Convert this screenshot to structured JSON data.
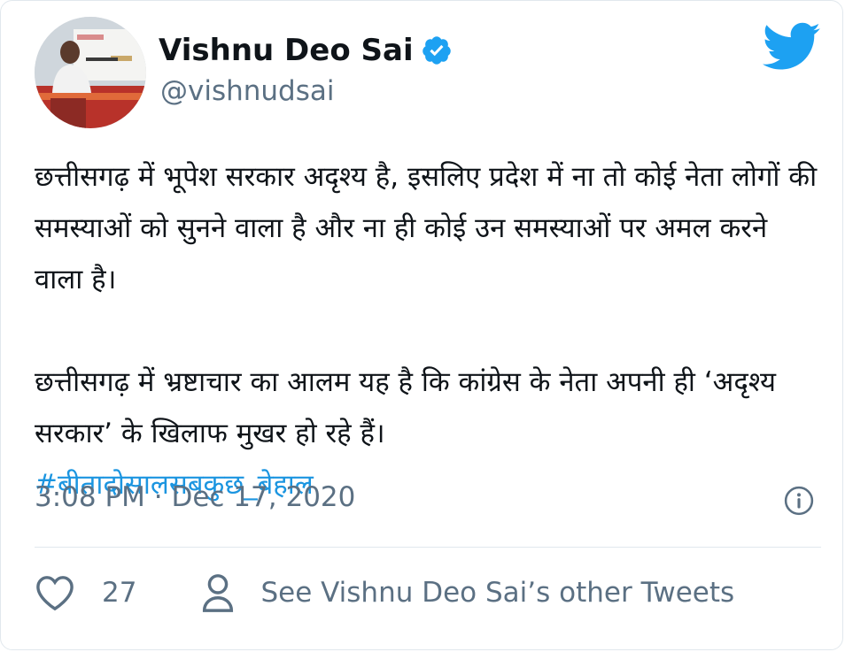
{
  "author": {
    "name": "Vishnu Deo Sai",
    "handle": "@vishnudsai",
    "avatar_icon": "profile-photo",
    "verified_icon": "verified-badge-icon",
    "verified_color": "#1da1f2"
  },
  "brand": {
    "icon": "twitter-bird-icon",
    "color": "#1da1f2"
  },
  "tweet": {
    "paragraph_1": "छत्तीसगढ़ में भूपेश सरकार अदृश्य है, इसलिए प्रदेश में ना तो कोई नेता लोगों की समस्याओं को सुनने वाला है और ना ही कोई उन समस्याओं पर अमल करने वाला है।",
    "paragraph_2": "छत्तीसगढ़ में भ्रष्टाचार का आलम यह है कि कांग्रेस के नेता अपनी ही ‘अदृश्य सरकार’ के खिलाफ मुखर हो रहे हैं।",
    "hashtag": "#बीतादोसालसबकुछ_बेहाल",
    "hashtag_color": "#1b95e0",
    "timestamp": "3:08 PM · Dec 17, 2020"
  },
  "footer": {
    "likes": "27",
    "other_tweets_label": "See Vishnu Deo Sai’s other Tweets",
    "icons": [
      "heart-icon",
      "person-icon",
      "info-icon"
    ]
  }
}
